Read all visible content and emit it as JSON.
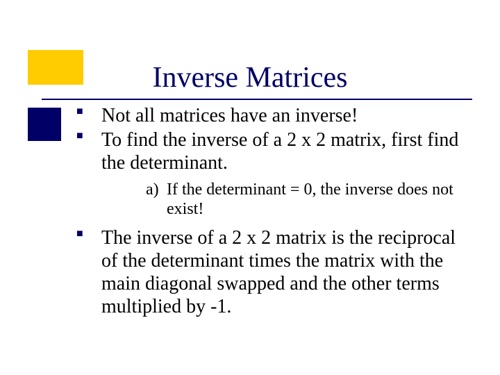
{
  "title": "Inverse Matrices",
  "bullets": {
    "b1": "Not all matrices have an inverse!",
    "b2": "To find the inverse of a 2 x 2 matrix, first find the determinant.",
    "b3": "The inverse of a 2 x 2 matrix is the reciprocal of the determinant times the matrix with the main diagonal swapped and the other terms multiplied by -1."
  },
  "sub": {
    "marker": "a)",
    "text": "If the determinant = 0, the inverse does not exist!"
  }
}
